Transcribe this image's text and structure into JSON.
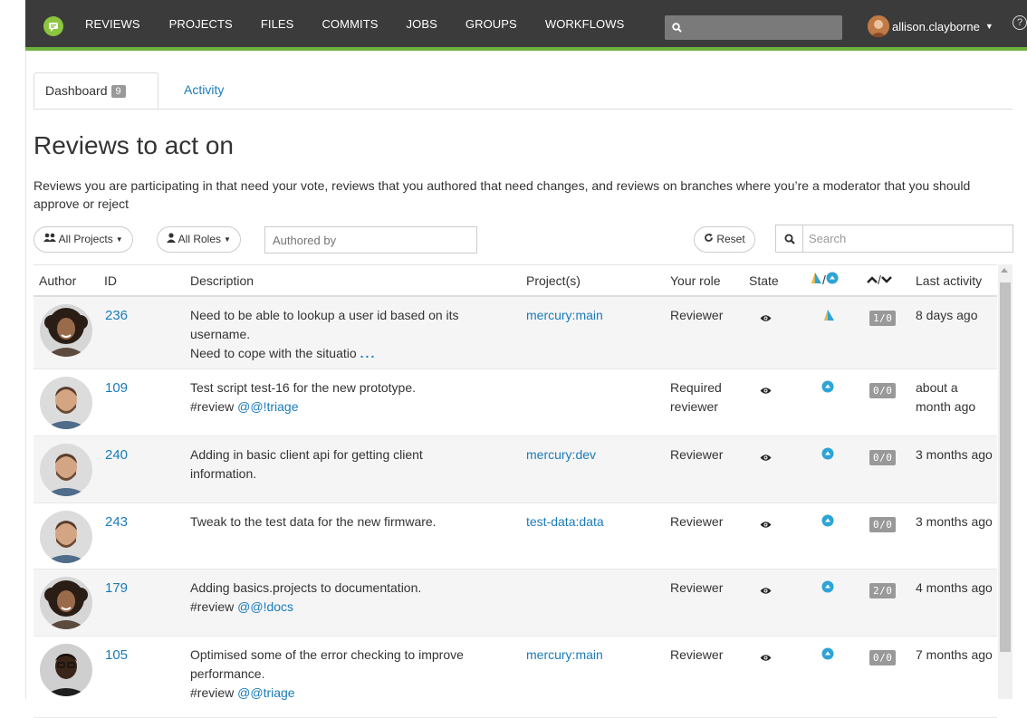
{
  "topnav": {
    "items": [
      "REVIEWS",
      "PROJECTS",
      "FILES",
      "COMMITS",
      "JOBS",
      "GROUPS",
      "WORKFLOWS"
    ],
    "username": "allison.clayborne"
  },
  "tabs": {
    "dashboard_label": "Dashboard",
    "dashboard_count": "9",
    "activity_label": "Activity"
  },
  "page": {
    "title": "Reviews to act on",
    "intro": "Reviews you are participating in that need your vote, reviews that you authored that need changes, and reviews on branches where you’re a moderator that you should approve or reject"
  },
  "filters": {
    "projects_label": "All Projects",
    "roles_label": "All Roles",
    "authored_placeholder": "Authored by",
    "reset_label": "Reset",
    "search_placeholder": "Search"
  },
  "table": {
    "headers": {
      "author": "Author",
      "id": "ID",
      "description": "Description",
      "projects": "Project(s)",
      "role": "Your role",
      "state": "State",
      "votes_sep": "/",
      "updown_sep": "/",
      "last_activity": "Last activity"
    },
    "rows": [
      {
        "id": "236",
        "desc": [
          "Need to be able to lookup a user id based on its",
          "username.",
          "Need to cope with the situatio"
        ],
        "more": "...",
        "mention_prefix": "",
        "mention": "",
        "project": "mercury:main",
        "role": "Reviewer",
        "test_icon": "flag-partial-icon",
        "votes": "1/0",
        "last": "8 days ago",
        "avatar": "woman-curly"
      },
      {
        "id": "109",
        "desc": [
          "Test script test-16 for the new prototype."
        ],
        "more": "",
        "mention_prefix": "#review ",
        "mention": "@@!triage",
        "project": "",
        "role": "Required reviewer",
        "test_icon": "arrow-up-circle-icon",
        "votes": "0/0",
        "last": "about a month ago",
        "avatar": "man-beard"
      },
      {
        "id": "240",
        "desc": [
          "Adding in basic client api for getting client",
          "information."
        ],
        "more": "",
        "mention_prefix": "",
        "mention": "",
        "project": "mercury:dev",
        "role": "Reviewer",
        "test_icon": "arrow-up-circle-icon",
        "votes": "0/0",
        "last": "3 months ago",
        "avatar": "man-beard"
      },
      {
        "id": "243",
        "desc": [
          "Tweak to the test data for the new firmware."
        ],
        "more": "",
        "mention_prefix": "",
        "mention": "",
        "project": "test-data:data",
        "role": "Reviewer",
        "test_icon": "arrow-up-circle-icon",
        "votes": "0/0",
        "last": "3 months ago",
        "avatar": "man-beard"
      },
      {
        "id": "179",
        "desc": [
          "Adding basics.projects to documentation."
        ],
        "more": "",
        "mention_prefix": "#review ",
        "mention": "@@!docs",
        "project": "",
        "role": "Reviewer",
        "test_icon": "arrow-up-circle-icon",
        "votes": "2/0",
        "last": "4 months ago",
        "avatar": "woman-curly"
      },
      {
        "id": "105",
        "desc": [
          "Optimised some of the error checking to improve",
          "performance."
        ],
        "more": "",
        "mention_prefix": "#review ",
        "mention": "@@triage",
        "project": "mercury:main",
        "role": "Reviewer",
        "test_icon": "arrow-up-circle-icon",
        "votes": "0/0",
        "last": "7 months ago",
        "avatar": "man-dark"
      }
    ]
  },
  "colors": {
    "accent": "#1a7bb9",
    "navbar": "#3b3b3b",
    "navbar_border": "#6cb33e",
    "test_pass": "#2ea3d6"
  }
}
